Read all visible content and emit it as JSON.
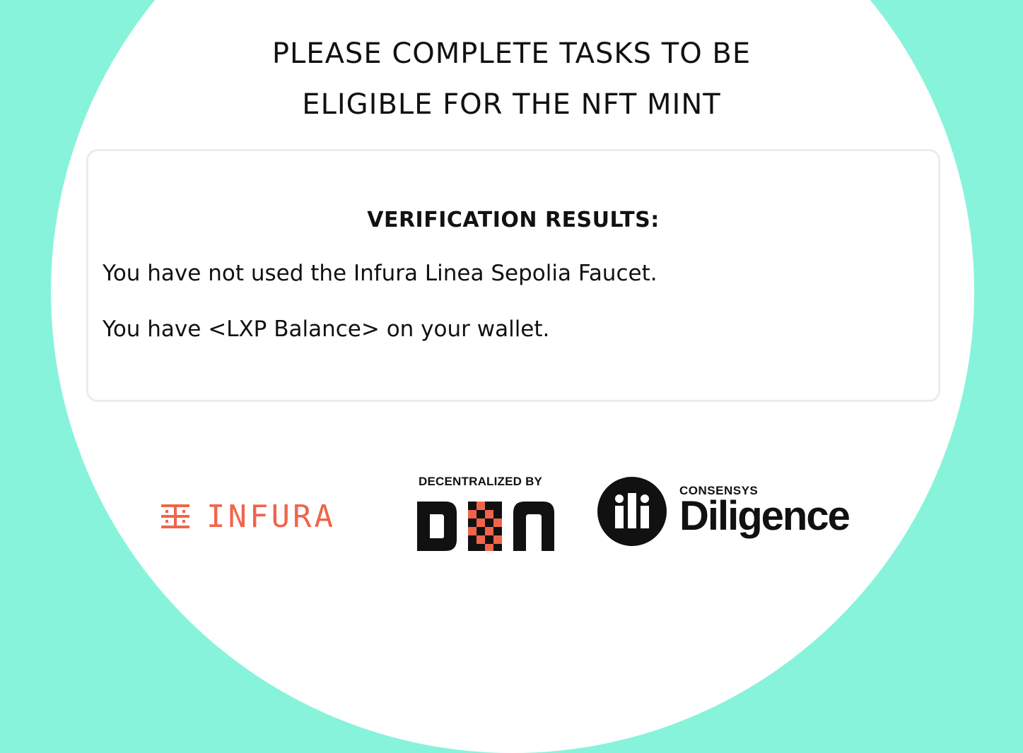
{
  "page": {
    "background_color": "#87F3DB",
    "title_line1": "PLEASE COMPLETE TASKS TO BE",
    "title_line2": "ELIGIBLE FOR THE NFT MINT"
  },
  "results": {
    "heading": "VERIFICATION RESULTS:",
    "line1": "You have not used the Infura Linea Sepolia Faucet.",
    "line2": "You have <LXP Balance> on your wallet."
  },
  "logos": {
    "infura": {
      "text": "INFURA",
      "color": "#F0654A",
      "icon": "infura-icon"
    },
    "din": {
      "caption": "DECENTRALIZED BY",
      "text": "DIN",
      "accent": "#F0654A",
      "icon": "din-logo"
    },
    "diligence": {
      "badge": "ili",
      "sub": "CONSENSYS",
      "text": "Diligence",
      "icon": "ili-icon"
    }
  }
}
